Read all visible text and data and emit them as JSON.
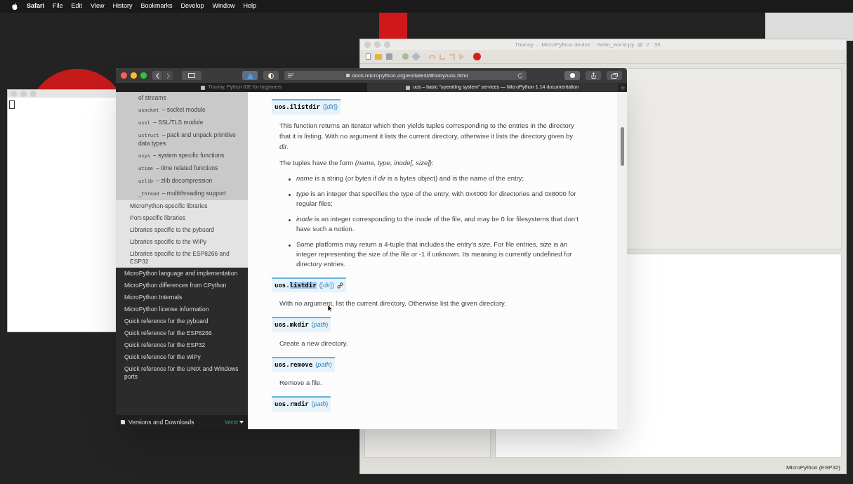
{
  "menu_bar": {
    "items": [
      {
        "label": "Safari",
        "kind": "app"
      },
      {
        "label": "File",
        "kind": "menu"
      },
      {
        "label": "Edit",
        "kind": "menu"
      },
      {
        "label": "View",
        "kind": "menu"
      },
      {
        "label": "History",
        "kind": "menu"
      },
      {
        "label": "Bookmarks",
        "kind": "menu"
      },
      {
        "label": "Develop",
        "kind": "menu"
      },
      {
        "label": "Window",
        "kind": "menu"
      },
      {
        "label": "Help",
        "kind": "menu"
      }
    ]
  },
  "thonny": {
    "title": "Thonny  -  MicroPython device :: /hello_world.py  @  2 : 39",
    "status": "MicroPython (ESP32)"
  },
  "browser": {
    "url": "docs.micropython.org/en/latest/library/uos.html",
    "tabs": [
      {
        "label": "Thonny, Python IDE for beginners",
        "selected": false
      },
      {
        "label": "uos – basic “operating system” services — MicroPython 1.14 documentation",
        "selected": true
      }
    ],
    "sidebar": {
      "items": [
        {
          "children": [
            {
              "children": [
                {
                  "text": "of streams"
                },
                {
                  "code": "usocket",
                  "text": "– socket module"
                },
                {
                  "code": "ussl",
                  "text": "– SSL/TLS module"
                },
                {
                  "code": "ustruct",
                  "text": "– pack and unpack primitive data types"
                },
                {
                  "code": "usys",
                  "text": "– system specific functions"
                },
                {
                  "code": "utime",
                  "text": "– time related functions"
                },
                {
                  "code": "uzlib",
                  "text": "– zlib decompression"
                },
                {
                  "code": "_thread",
                  "text": "– multithreading support"
                }
              ]
            },
            {
              "text": "MicroPython-specific libraries"
            },
            {
              "text": "Port-specific libraries"
            },
            {
              "text": "Libraries specific to the pyboard"
            },
            {
              "text": "Libraries specific to the WiPy"
            },
            {
              "text": "Libraries specific to the ESP8266 and ESP32"
            }
          ]
        },
        {
          "text": "MicroPython language and implementation"
        },
        {
          "text": "MicroPython differences from CPython"
        },
        {
          "text": "MicroPython Internals"
        },
        {
          "text": "MicroPython license information"
        },
        {
          "text": "Quick reference for the pyboard"
        },
        {
          "text": "Quick reference for the ESP8266"
        },
        {
          "text": "Quick reference for the ESP32"
        },
        {
          "text": "Quick reference for the WiPy"
        },
        {
          "text": "Quick reference for the UNIX and Windows ports"
        }
      ],
      "footer": {
        "label": "Versions and Downloads",
        "version": "latest"
      }
    },
    "sections": [
      {
        "prefix": "uos.",
        "name": "ilistdir",
        "args": "([*dir*])",
        "selected": false,
        "permalink": false,
        "body": [
          {
            "kind": "para",
            "text": "This function returns an iterator which then yields tuples corresponding to the entries in the directory that it is listing. With no argument it lists the current directory, otherwise it lists the directory given by *dir*."
          },
          {
            "kind": "para",
            "text": "The tuples have the form *(name, type, inode[, size])*:"
          },
          {
            "kind": "bullet",
            "text": "*name* is a string (or bytes if *dir* is a bytes object) and is the name of the entry;"
          },
          {
            "kind": "bullet",
            "text": "*type* is an integer that specifies the type of the entry, with 0x4000 for directories and 0x8000 for regular files;"
          },
          {
            "kind": "bullet",
            "text": "*inode* is an integer corresponding to the inode of the file, and may be 0 for filesystems that don’t have such a notion."
          },
          {
            "kind": "bullet",
            "text": "Some platforms may return a 4-tuple that includes the entry’s *size*. For file entries, *size* is an integer representing the size of the file or -1 if unknown. Its meaning is currently undefined for directory entries."
          }
        ]
      },
      {
        "prefix": "uos.",
        "name": "listdir",
        "args": "([*dir*])",
        "selected": true,
        "permalink": true,
        "body": [
          {
            "kind": "para",
            "text": "With no argument, list the current directory. Otherwise list the given directory."
          }
        ]
      },
      {
        "prefix": "uos.",
        "name": "mkdir",
        "args": "(*path*)",
        "selected": false,
        "permalink": false,
        "body": [
          {
            "kind": "para",
            "text": "Create a new directory."
          }
        ]
      },
      {
        "prefix": "uos.",
        "name": "remove",
        "args": "(*path*)",
        "selected": false,
        "permalink": false,
        "body": [
          {
            "kind": "para",
            "text": "Remove a file."
          }
        ]
      },
      {
        "prefix": "uos.",
        "name": "rmdir",
        "args": "(*path*)",
        "selected": false,
        "permalink": false
      }
    ]
  }
}
